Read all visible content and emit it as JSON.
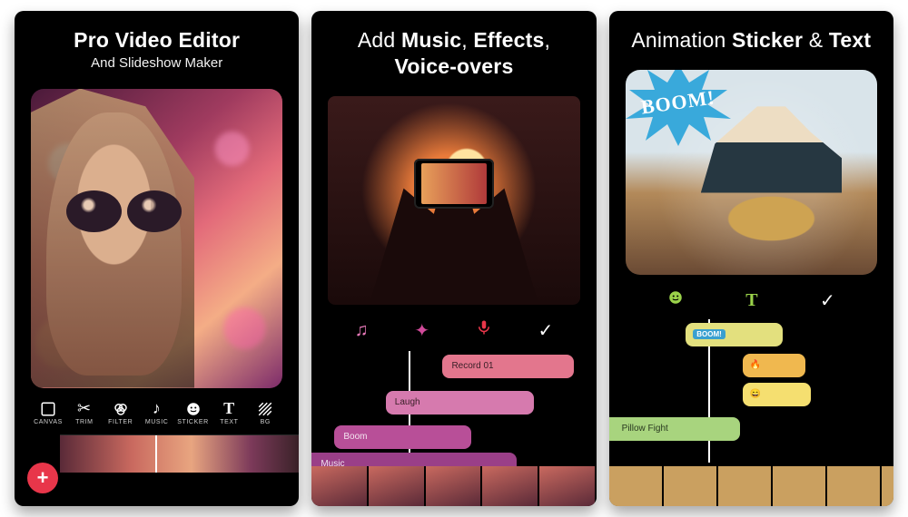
{
  "panel1": {
    "title_bold": "Pro Video Editor",
    "subtitle": "And Slideshow Maker",
    "tools": [
      {
        "name": "canvas",
        "label": "CANVAS"
      },
      {
        "name": "trim",
        "label": "TRIM"
      },
      {
        "name": "filter",
        "label": "FILTER"
      },
      {
        "name": "music",
        "label": "MUSIC"
      },
      {
        "name": "sticker",
        "label": "STICKER"
      },
      {
        "name": "text",
        "label": "TEXT"
      },
      {
        "name": "bg",
        "label": "BG"
      }
    ],
    "fab": "+"
  },
  "panel2": {
    "title_pre": "Add ",
    "title_b1": "Music",
    "title_mid1": ", ",
    "title_b2": "Effects",
    "title_mid2": ",",
    "title_b3": "Voice-overs",
    "tracks": [
      {
        "label": "Record 01"
      },
      {
        "label": "Laugh"
      },
      {
        "label": "Boom"
      },
      {
        "label": "Music"
      }
    ]
  },
  "panel3": {
    "title_pre": "Animation ",
    "title_b1": "Sticker",
    "title_mid": " & ",
    "title_b2": "Text",
    "boom": "BOOM!",
    "stickers": [
      {
        "chip": "BOOM!"
      },
      {
        "emoji": "🔥"
      },
      {
        "emoji": "😄"
      },
      {
        "label": "Pillow Fight"
      }
    ]
  }
}
